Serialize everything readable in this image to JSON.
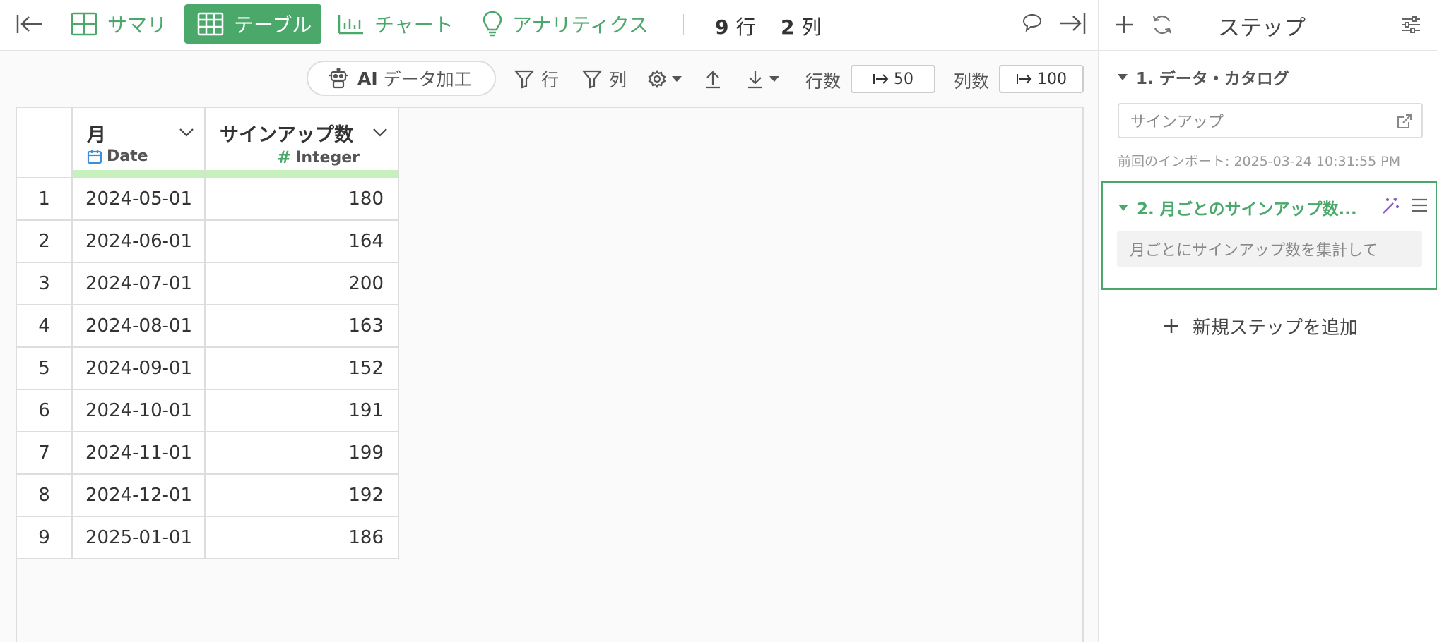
{
  "colors": {
    "accent": "#4aa86a",
    "date_icon": "#3a8fd8",
    "magic_icon": "#8a5cc4",
    "type_bar": "#c6f0bc"
  },
  "topbar": {
    "tabs": [
      {
        "label": "サマリ",
        "icon": "summary-grid-icon"
      },
      {
        "label": "テーブル",
        "icon": "table-grid-icon",
        "active": true
      },
      {
        "label": "チャート",
        "icon": "bar-chart-icon"
      },
      {
        "label": "アナリティクス",
        "icon": "lightbulb-icon"
      }
    ],
    "rows_count": "9",
    "rows_unit": "行",
    "cols_count": "2",
    "cols_unit": "列"
  },
  "toolbar": {
    "ai_prefix": "AI",
    "ai_label": "データ加工",
    "filter_rows": "行",
    "filter_cols": "列",
    "rows_label": "行数",
    "rows_value": "50",
    "cols_label": "列数",
    "cols_value": "100"
  },
  "table": {
    "columns": [
      {
        "name": "月",
        "type": "Date"
      },
      {
        "name": "サインアップ数",
        "type": "Integer"
      }
    ],
    "rows": [
      {
        "idx": "1",
        "date": "2024-05-01",
        "value": "180"
      },
      {
        "idx": "2",
        "date": "2024-06-01",
        "value": "164"
      },
      {
        "idx": "3",
        "date": "2024-07-01",
        "value": "200"
      },
      {
        "idx": "4",
        "date": "2024-08-01",
        "value": "163"
      },
      {
        "idx": "5",
        "date": "2024-09-01",
        "value": "152"
      },
      {
        "idx": "6",
        "date": "2024-10-01",
        "value": "191"
      },
      {
        "idx": "7",
        "date": "2024-11-01",
        "value": "199"
      },
      {
        "idx": "8",
        "date": "2024-12-01",
        "value": "192"
      },
      {
        "idx": "9",
        "date": "2025-01-01",
        "value": "186"
      }
    ]
  },
  "steps": {
    "title": "ステップ",
    "step1": {
      "title": "1. データ・カタログ",
      "source": "サインアップ",
      "import_info": "前回のインポート: 2025-03-24 10:31:55 PM"
    },
    "step2": {
      "title": "2. 月ごとのサインアップ数...",
      "description": "月ごとにサインアップ数を集計して"
    },
    "add_step": "新規ステップを追加"
  }
}
